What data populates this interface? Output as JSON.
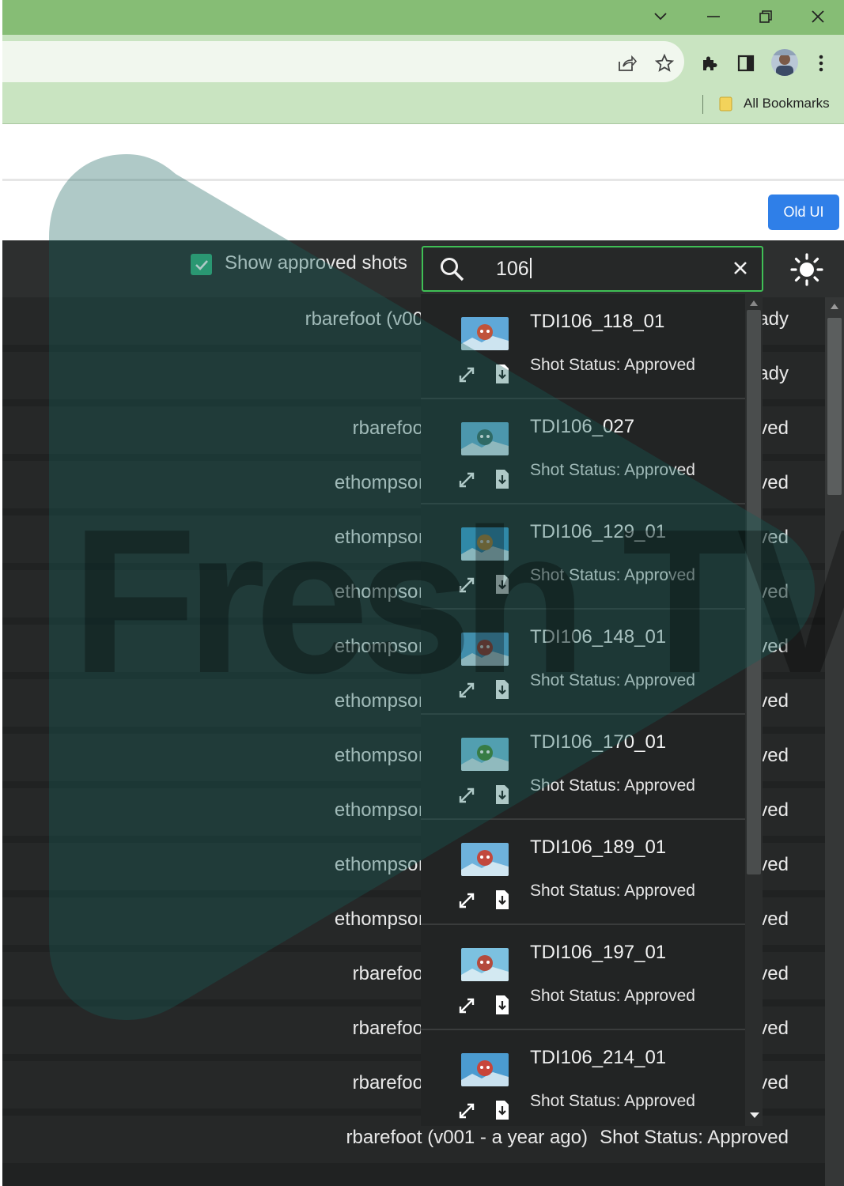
{
  "browser": {
    "window_controls": [
      "chevron-down-icon",
      "minimize-icon",
      "restore-icon",
      "close-icon"
    ],
    "toolbar_icons": [
      "share-icon",
      "bookmark-star-icon",
      "extensions-icon",
      "side-panel-icon",
      "profile-avatar",
      "more-menu-icon"
    ],
    "bookmarks_label": "All Bookmarks"
  },
  "header": {
    "old_ui_label": "Old UI"
  },
  "appbar": {
    "show_approved_label": "Show approved shots",
    "show_approved_checked": true,
    "search_value": "106"
  },
  "rows": [
    {
      "user": "rbarefoot (v00",
      "status": "ady"
    },
    {
      "user": "",
      "status": "ady"
    },
    {
      "user": "rbarefoo",
      "status": "ved"
    },
    {
      "user": "ethompsoı",
      "status": "ved"
    },
    {
      "user": "ethompsoı",
      "status": "ved"
    },
    {
      "user": "ethompsoı",
      "status": "ved"
    },
    {
      "user": "ethompsoı",
      "status": "ved"
    },
    {
      "user": "ethompsoı",
      "status": "ved"
    },
    {
      "user": "ethompsoı",
      "status": "ved"
    },
    {
      "user": "ethompsoı",
      "status": "ved"
    },
    {
      "user": "ethompsoı",
      "status": "ved"
    },
    {
      "user": "ethompsoı",
      "status": "ved"
    },
    {
      "user": "rbarefoo",
      "status": "ved"
    },
    {
      "user": "rbarefoo",
      "status": "ved"
    },
    {
      "user": "rbarefoo",
      "status": "ved"
    },
    {
      "user": "rbarefoot (v001 - a year ago)",
      "status": "Shot Status: Approved"
    }
  ],
  "dropdown": {
    "items": [
      {
        "name": "TDI106_118_01",
        "status": "Shot Status: Approved",
        "thumb_bg": "#5fa8d8",
        "thumb_fg": "#c0533a"
      },
      {
        "name": "TDI106_027",
        "status": "Shot Status: Approved",
        "thumb_bg": "#6ab4d8",
        "thumb_fg": "#3d6f6b"
      },
      {
        "name": "TDI106_129_01",
        "status": "Shot Status: Approved",
        "thumb_bg": "#3f9ed0",
        "thumb_fg": "#d9a24a"
      },
      {
        "name": "TDI106_148_01",
        "status": "Shot Status: Approved",
        "thumb_bg": "#58a6d6",
        "thumb_fg": "#b5453a"
      },
      {
        "name": "TDI106_170_01",
        "status": "Shot Status: Approved",
        "thumb_bg": "#72c0dc",
        "thumb_fg": "#4a8a3a"
      },
      {
        "name": "TDI106_189_01",
        "status": "Shot Status: Approved",
        "thumb_bg": "#6eb2dc",
        "thumb_fg": "#c2483d"
      },
      {
        "name": "TDI106_197_01",
        "status": "Shot Status: Approved",
        "thumb_bg": "#7cc1e0",
        "thumb_fg": "#b44a3c"
      },
      {
        "name": "TDI106_214_01",
        "status": "Shot Status: Approved",
        "thumb_bg": "#4b9bd0",
        "thumb_fg": "#c8453a"
      }
    ]
  },
  "watermark": {
    "text": "Fresh TV"
  },
  "colors": {
    "titlebar": "#86bd75",
    "toolbar": "#c9e4c1",
    "accent_green": "#36b37e",
    "search_border": "#3fbf55",
    "old_ui_button": "#2f7fe8",
    "app_dark": "#2d2f2f"
  }
}
